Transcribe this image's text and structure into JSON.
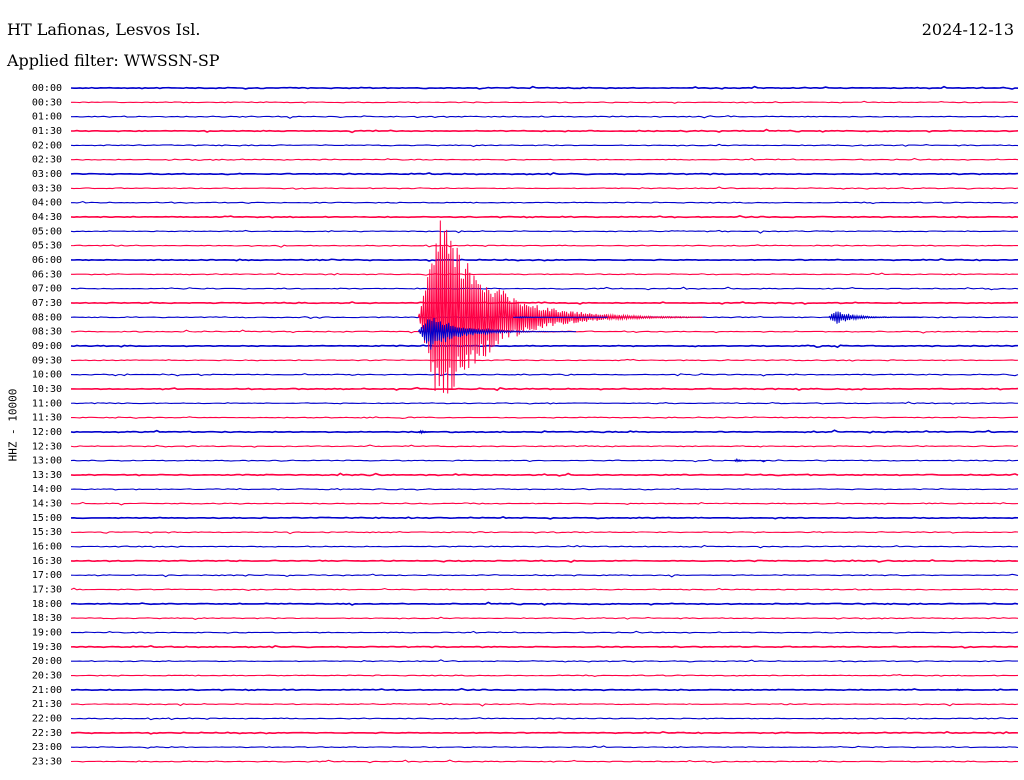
{
  "header": {
    "station": "HT Lafionas, Lesvos Isl.",
    "date": "2024-12-13",
    "filter": "Applied filter: WWSSN-SP"
  },
  "chart_data": {
    "type": "line",
    "title": "HT Lafionas, Lesvos Isl.",
    "ylabel": "HHZ - 10000",
    "xlabel": "",
    "row_labels": [
      "00:00",
      "00:30",
      "01:00",
      "01:30",
      "02:00",
      "02:30",
      "03:00",
      "03:30",
      "04:00",
      "04:30",
      "05:00",
      "05:30",
      "06:00",
      "06:30",
      "07:00",
      "07:30",
      "08:00",
      "08:30",
      "09:00",
      "09:30",
      "10:00",
      "10:30",
      "11:00",
      "11:30",
      "12:00",
      "12:30",
      "13:00",
      "13:30",
      "14:00",
      "14:30",
      "15:00",
      "15:30",
      "16:00",
      "16:30",
      "17:00",
      "17:30",
      "18:00",
      "18:30",
      "19:00",
      "19:30",
      "20:00",
      "20:30",
      "21:00",
      "21:30",
      "22:00",
      "22:30",
      "23:00",
      "23:30"
    ],
    "row_minutes": 30,
    "series_colors": [
      "#0000cc",
      "#ff0044"
    ],
    "events": [
      {
        "row": 16,
        "minute": 11,
        "peak_amplitude_rows": 7.0,
        "duration_min": 9,
        "color": "#ff0044"
      },
      {
        "row": 17,
        "minute": 11,
        "peak_amplitude_rows": 1.3,
        "duration_min": 5,
        "color": "#0000cc"
      },
      {
        "row": 16,
        "minute": 14,
        "peak_amplitude_rows": 0.05,
        "duration_min": 3,
        "color": "#0000cc"
      },
      {
        "row": 16,
        "minute": 24,
        "peak_amplitude_rows": 0.55,
        "duration_min": 3,
        "color": "#0000cc"
      },
      {
        "row": 24,
        "minute": 11,
        "peak_amplitude_rows": 0.1,
        "duration_min": 1,
        "color": "#0000cc"
      },
      {
        "row": 26,
        "minute": 21,
        "peak_amplitude_rows": 0.1,
        "duration_min": 1,
        "color": "#0000cc"
      },
      {
        "row": 42,
        "minute": 28,
        "peak_amplitude_rows": 0.08,
        "duration_min": 1,
        "color": "#0000cc"
      }
    ]
  }
}
